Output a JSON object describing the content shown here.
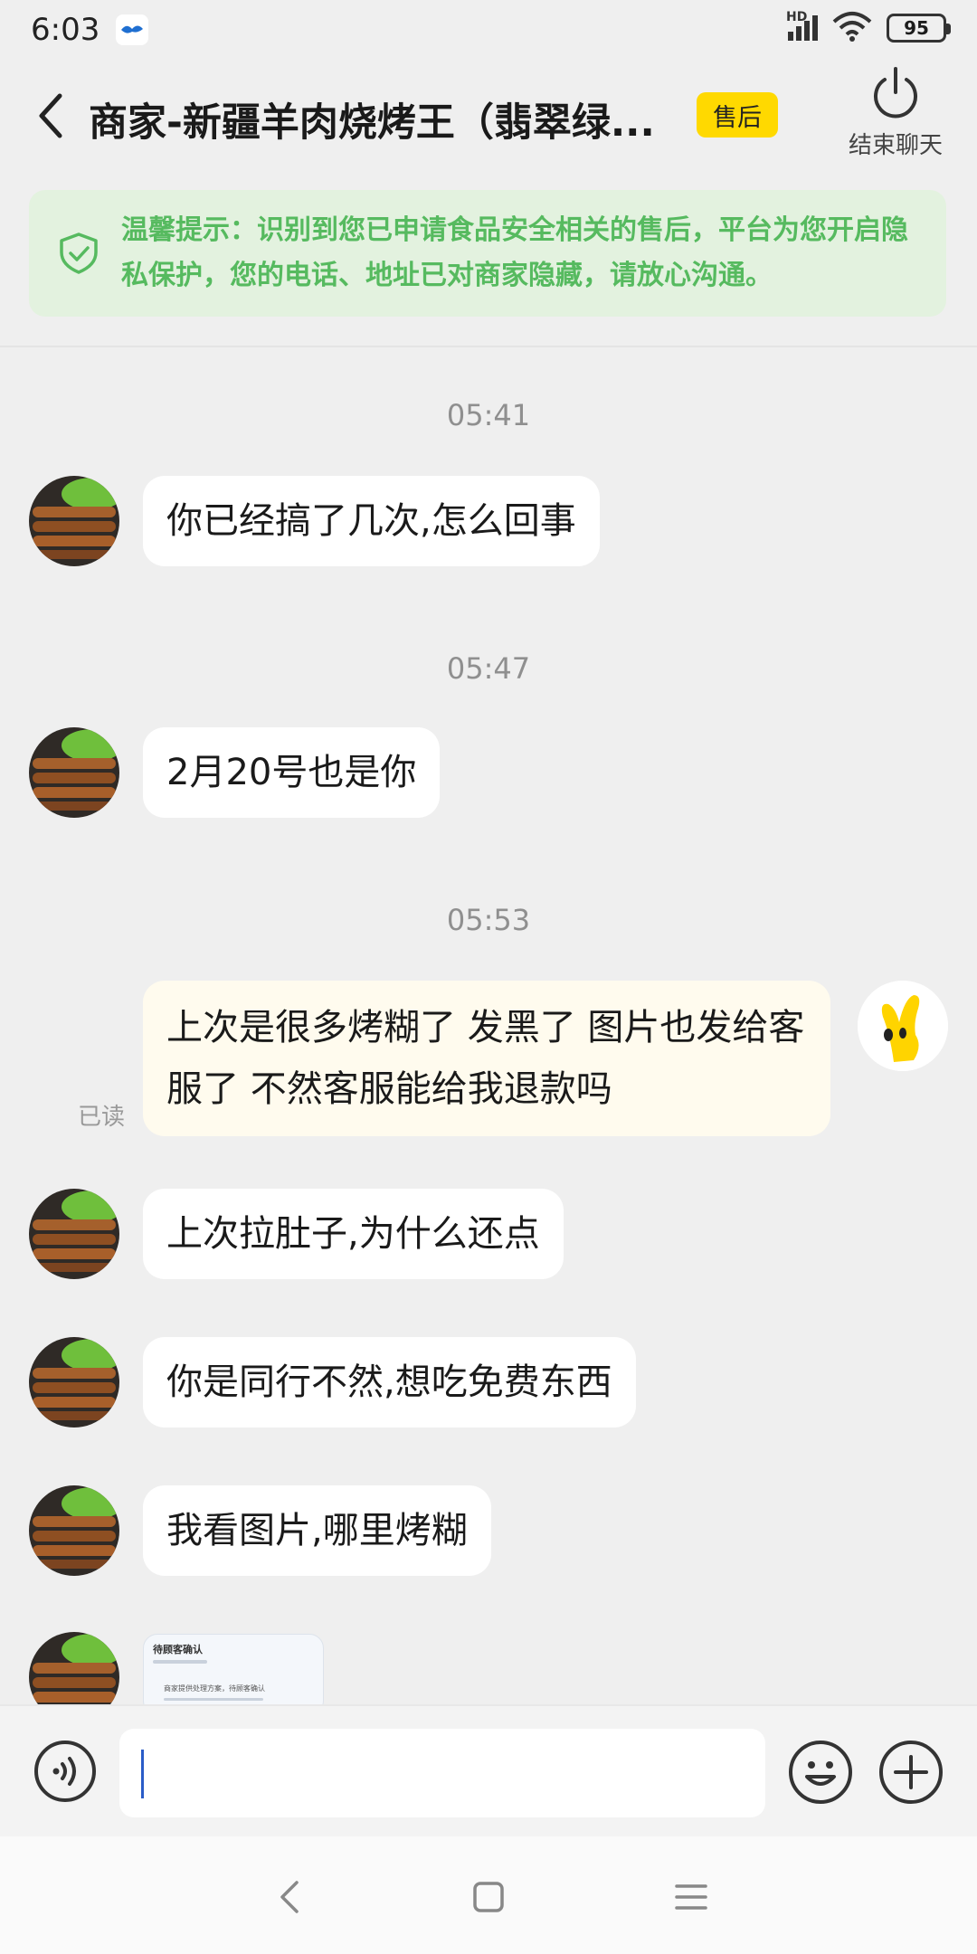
{
  "status_bar": {
    "time": "6:03",
    "hd_label": "HD",
    "battery": "95"
  },
  "header": {
    "title": "商家-新疆羊肉烧烤王（翡翠绿...",
    "badge": "售后",
    "end_chat_label": "结束聊天"
  },
  "notice": {
    "text": "温馨提示：识别到您已申请食品安全相关的售后，平台为您开启隐私保护，您的电话、地址已对商家隐藏，请放心沟通。"
  },
  "messages": [
    {
      "time": "05:41"
    },
    {
      "from": "merchant",
      "text": "你已经搞了几次,怎么回事"
    },
    {
      "time": "05:47"
    },
    {
      "from": "merchant",
      "text": "2月20号也是你"
    },
    {
      "time": "05:53"
    },
    {
      "from": "me",
      "text": "上次是很多烤糊了  发黑了      图片也发给客服了  不然客服能给我退款吗",
      "status": "已读"
    },
    {
      "from": "merchant",
      "text": "上次拉肚子,为什么还点"
    },
    {
      "from": "merchant",
      "text": "你是同行不然,想吃免费东西"
    },
    {
      "from": "merchant",
      "text": "我看图片,哪里烤糊"
    },
    {
      "from": "merchant",
      "type": "image",
      "thumb_title": "待顾客确认",
      "thumb_subtitle": "商家提供处理方案，待顾客确认"
    }
  ],
  "input": {
    "value": "",
    "placeholder": ""
  },
  "colors": {
    "accent_yellow": "#ffd900",
    "notice_green": "#56ba5f",
    "notice_bg": "#e3f2df",
    "my_bubble": "#fffbee"
  },
  "icons": {
    "back": "back-arrow-icon",
    "end_chat": "power-icon",
    "notice": "shield-check-icon",
    "voice": "voice-icon",
    "emoji": "smile-icon",
    "plus": "plus-circle-icon"
  }
}
